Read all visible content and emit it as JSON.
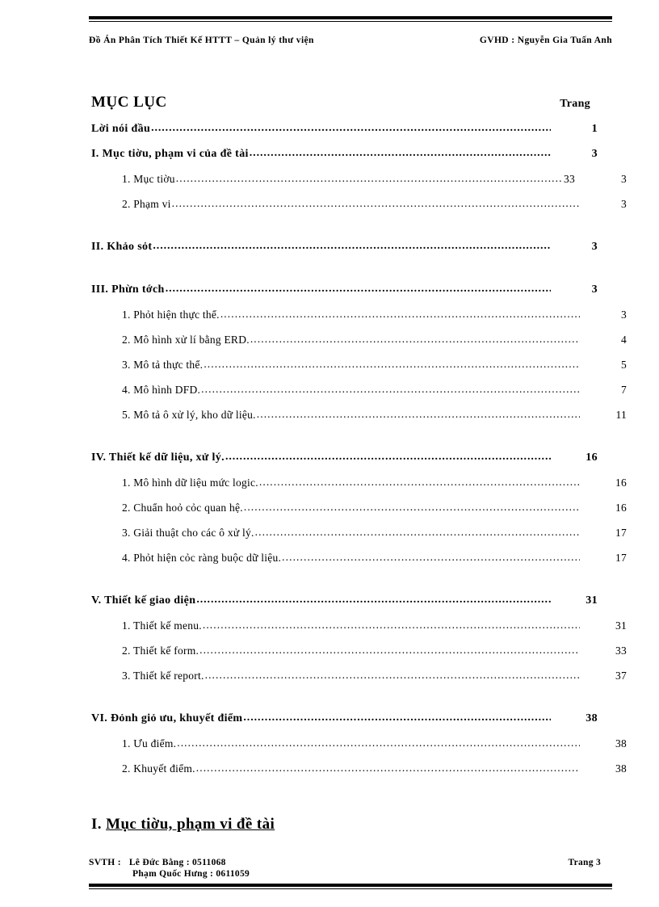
{
  "header": {
    "left": "Đồ Án  Phân Tích Thiết Kế  HTTT  – Quản lý thư viện",
    "right": "GVHD  : Nguyễn Gia Tuấn Anh"
  },
  "toc": {
    "title": "MỤC LỤC",
    "page_column_header": "Trang",
    "entries": [
      {
        "level": 1,
        "label": "Lời nói đầu",
        "page": "1",
        "extra": ""
      },
      {
        "level": 1,
        "label": "I. Mục tiờu, phạm  vi của đề tài",
        "page": "3",
        "extra": ""
      },
      {
        "level": 2,
        "label": "1. Mục tiờu",
        "page": "3",
        "extra": "33"
      },
      {
        "level": 2,
        "label": "2. Phạm  vi",
        "page": "3",
        "extra": ""
      },
      {
        "level": 1,
        "label": "II. Khảo sỏt",
        "page": "3",
        "extra": "",
        "space_before": "md"
      },
      {
        "level": 1,
        "label": "III. Phừn tớch",
        "page": "3",
        "extra": "",
        "space_before": "md"
      },
      {
        "level": 2,
        "label": "1. Phỏt hiện  thực thể.",
        "page": "3",
        "extra": ""
      },
      {
        "level": 2,
        "label": "2. Mô hình  xử lí bằng ERD.",
        "page": "4",
        "extra": ""
      },
      {
        "level": 2,
        "label": "3. Mô tả thực thể.",
        "page": "5",
        "extra": ""
      },
      {
        "level": 2,
        "label": "4. Mô hình  DFD.",
        "page": "7",
        "extra": ""
      },
      {
        "level": 2,
        "label": "5. Mô tả ô xử lý, kho dữ liệu.",
        "page": "11",
        "extra": ""
      },
      {
        "level": 1,
        "label": "IV. Thiết kế dữ liệu, xử lý.",
        "page": "16",
        "extra": "",
        "space_before": "md"
      },
      {
        "level": 2,
        "label": "1. Mô hình  dữ liệu  mức logic.",
        "page": "16",
        "extra": ""
      },
      {
        "level": 2,
        "label": "2. Chuẩn hoỏ cỏc quan hệ.",
        "page": "16",
        "extra": ""
      },
      {
        "level": 2,
        "label": "3. Giải  thuật  cho các ô xử lý.",
        "page": "17",
        "extra": ""
      },
      {
        "level": 2,
        "label": "4. Phỏt hiện  cỏc ràng buộc dữ liệu.",
        "page": "17",
        "extra": ""
      },
      {
        "level": 1,
        "label": "V. Thiết kế giao diện",
        "page": "31",
        "extra": "",
        "space_before": "md"
      },
      {
        "level": 2,
        "label": "1. Thiết  kế menu.",
        "page": "31",
        "extra": ""
      },
      {
        "level": 2,
        "label": "2. Thiết  kế form.",
        "page": "33",
        "extra": ""
      },
      {
        "level": 2,
        "label": "3. Thiết  kế report.",
        "page": "37",
        "extra": ""
      },
      {
        "level": 1,
        "label": "VI. Đỏnh giỏ ưu, khuyết điểm",
        "page": "38",
        "extra": "",
        "space_before": "md"
      },
      {
        "level": 2,
        "label": "1. Ưu điểm.",
        "page": "38",
        "extra": ""
      },
      {
        "level": 2,
        "label": "2. Khuyết  điểm.",
        "page": "38",
        "extra": ""
      }
    ]
  },
  "section_heading": {
    "number": "I. ",
    "text": "Mục tiờu, phạm vi đề tài "
  },
  "footer": {
    "svth_label": "SVTH :",
    "student_1": "Lê Đức Bằng : 0511068",
    "student_2": "Phạm  Quốc  Hưng  : 0611059",
    "page_label": "Trang  3"
  }
}
